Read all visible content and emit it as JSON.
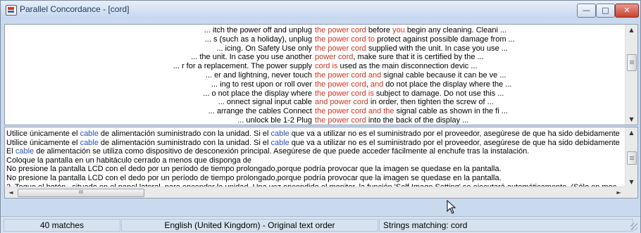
{
  "window": {
    "title": "Parallel Concordance - [cord]",
    "controls": {
      "minimize": "—",
      "maximize": "□",
      "close": "✕"
    }
  },
  "concordance_lines": [
    {
      "left": "... itch the power off and unplug ",
      "k1": "the power cord",
      "m": " before ",
      "k2": "you",
      "right": " begin any cleaning.  Cleani ..."
    },
    {
      "left": "... s (such as a holiday), unplug ",
      "k1": "the power cord",
      "m": " ",
      "k2": "to",
      "right": " protect against possible damage from ..."
    },
    {
      "left": "... icing.  On Safety  Use only ",
      "k1": "the power cord",
      "m": "",
      "k2": "",
      "right": " supplied with the unit. In case you use ..."
    },
    {
      "left": "... the unit. In case you use another ",
      "k1": "power cord",
      "m": ", make sure that it is certified by the ...",
      "k2": "",
      "right": ""
    },
    {
      "left": "... r for a replacement.  The power supply ",
      "k1": "cord",
      "m": " ",
      "k2": "is",
      "right": " used as the main disconnection devic ..."
    },
    {
      "left": "... er and lightning, never touch ",
      "k1": "the power cord",
      "m": " ",
      "k2": "and",
      "right": " signal  cable because it can be ve ..."
    },
    {
      "left": "... ing to rest upon or roll over ",
      "k1": "the power cord",
      "m": ", ",
      "k2": "and",
      "right": " do not place the display where the ..."
    },
    {
      "left": "... o not place the display where ",
      "k1": "the power cord",
      "m": " ",
      "k2": "is",
      "right": " subject to damage.  Do not use this ..."
    },
    {
      "left": "... onnect signal input cable  ",
      "k1": "and power cord",
      "m": " in order, then tighten the screw of ...",
      "k2": "",
      "right": ""
    },
    {
      "left": "... arrange the cables  Connect ",
      "k1": "the power cord",
      "m": " ",
      "k2": "and the",
      "right": " signal cable as shown in the fi ..."
    },
    {
      "left": "...                 unlock  ble  1-2  Plug ",
      "k1": "the power cord",
      "m": " into the back of the display ...",
      "k2": "",
      "right": ""
    }
  ],
  "translation_lines": [
    {
      "a": "Utilice únicamente el ",
      "h1": "cable",
      "b": " de alimentación suministrado con la unidad. Si el ",
      "h2": "cable",
      "c": " que va a utilizar no es el suministrado por el proveedor, asegúrese de que ha sido debidamente"
    },
    {
      "a": "Utilice únicamente el ",
      "h1": "cable",
      "b": " de alimentación suministrado con la unidad. Si el ",
      "h2": "cable",
      "c": " que va a utilizar no es el suministrado por el proveedor, asegúrese de que ha sido debidamente"
    },
    {
      "a": "El ",
      "h1": "cable",
      "b": " de alimentación se utiliza como dispositivo de desconexión principal. Asegúrese de que puede acceder fácilmente al enchufe tras la instalación.",
      "h2": "",
      "c": ""
    },
    {
      "a": "Coloque la pantalla en un habitáculo cerrado a menos que disponga de",
      "h1": "",
      "b": "",
      "h2": "",
      "c": ""
    },
    {
      "a": "No presione la pantalla LCD con el dedo por un período de tiempo prolongado,porque podría provocar que la imagen se quedase en la pantalla.",
      "h1": "",
      "b": "",
      "h2": "",
      "c": ""
    },
    {
      "a": "No presione la pantalla LCD con el dedo por un período de tiempo prolongado,porque podría provocar que la imagen se quedase en la pantalla.",
      "h1": "",
      "b": "",
      "h2": "",
      "c": ""
    },
    {
      "a": "2. Toque el botón , situado en el panel lateral, para encender la unidad. Una vez encendido el monitor, la función 'Self Image Setting' se ejecutará automáticamente. (Sólo en moc",
      "h1": "",
      "b": "",
      "h2": "",
      "c": ""
    }
  ],
  "scroll": {
    "up": "▲",
    "down": "▼",
    "left": "◄",
    "right": "►",
    "grip": "III"
  },
  "status": {
    "matches": "40 matches",
    "language": "English (United Kingdom) - Original text order",
    "strings": "Strings matching: cord"
  },
  "colors": {
    "keyword": "#d2331f",
    "highlight": "#2b50b8"
  }
}
